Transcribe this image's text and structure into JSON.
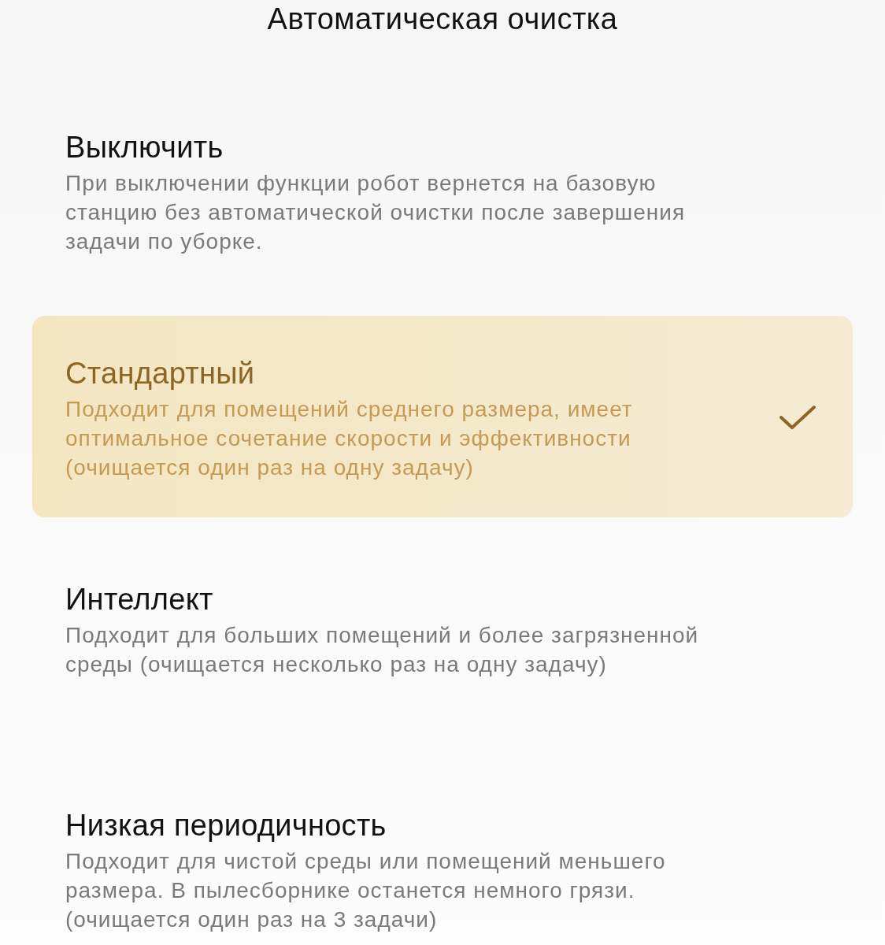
{
  "title": "Автоматическая очистка",
  "options": [
    {
      "name": "Выключить",
      "description": "При выключении функции робот вернется на базовую станцию без автоматической очистки после завершения задачи по уборке.",
      "selected": false
    },
    {
      "name": "Стандартный",
      "description": "Подходит для помещений среднего размера, имеет оптимальное сочетание скорости и эффективности (очищается один раз на одну задачу)",
      "selected": true
    },
    {
      "name": "Интеллект",
      "description": "Подходит для больших помещений и более загрязненной среды (очищается несколько раз на одну задачу)",
      "selected": false
    },
    {
      "name": "Низкая периодичность",
      "description": "Подходит для чистой среды или помещений меньшего размера. В пылесборнике останется немного грязи. (очищается один раз на 3 задачи)",
      "selected": false
    }
  ]
}
